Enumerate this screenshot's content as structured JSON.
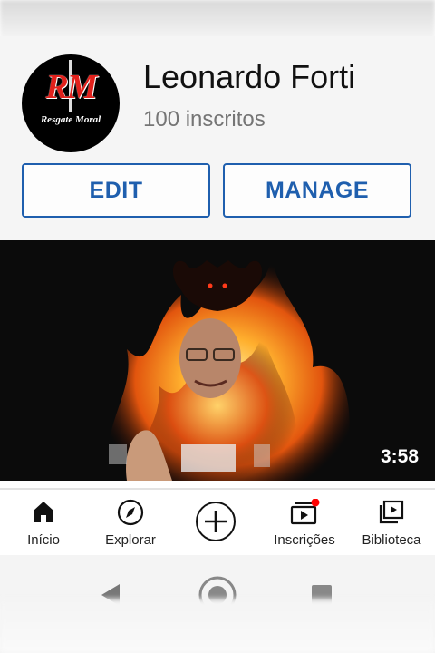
{
  "channel": {
    "name": "Leonardo Forti",
    "subscribers": "100 inscritos",
    "logo_text": "RM",
    "logo_subtext": "Resgate Moral"
  },
  "actions": {
    "edit_label": "EDIT",
    "manage_label": "MANAGE"
  },
  "video": {
    "duration": "3:58"
  },
  "bottom_nav": {
    "items": [
      {
        "label": "Início",
        "icon": "home-icon"
      },
      {
        "label": "Explorar",
        "icon": "compass-icon"
      },
      {
        "label": "",
        "icon": "add-icon"
      },
      {
        "label": "Inscrições",
        "icon": "subscriptions-icon",
        "badge": true
      },
      {
        "label": "Biblioteca",
        "icon": "library-icon"
      }
    ]
  },
  "colors": {
    "accent": "#1f5fae",
    "badge": "#ff0000",
    "logo_red": "#e2211c"
  }
}
